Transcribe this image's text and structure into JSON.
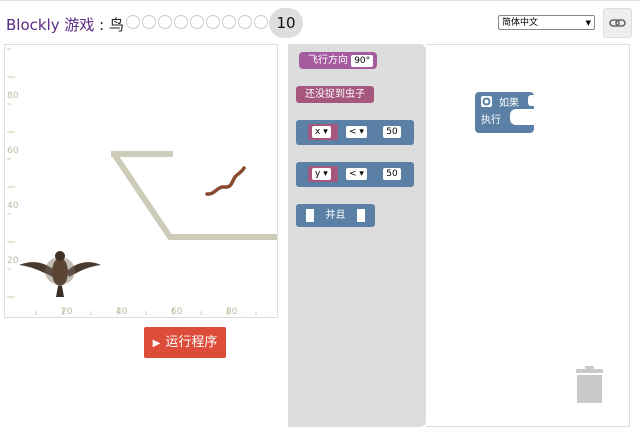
{
  "header": {
    "title_brand": "Blockly 游戏",
    "title_sep": " : ",
    "title_game": "鸟",
    "level_dots_count": 9,
    "current_level": "10",
    "language": "简体中文",
    "link_icon": "link-icon"
  },
  "viz": {
    "y_ticks": [
      "80",
      "60",
      "40",
      "20"
    ],
    "x_ticks": [
      "20",
      "40",
      "60",
      "80"
    ],
    "wall_color": "#ccccb8",
    "bird_icon": "bird-icon",
    "worm_icon": "worm-icon"
  },
  "run": {
    "label": "运行程序",
    "icon": "play-icon",
    "color": "#dd4b39"
  },
  "flyout": {
    "heading_block": {
      "label": "飞行方向",
      "value": "90°"
    },
    "no_worm_block": {
      "label": "还没捉到虫子"
    },
    "compare_x": {
      "var": "x",
      "op": "<",
      "value": "50"
    },
    "compare_y": {
      "var": "y",
      "op": "<",
      "value": "50"
    },
    "and_block": {
      "label": "并且"
    }
  },
  "workspace": {
    "if_block": {
      "if_label": "如果",
      "do_label": "执行"
    },
    "trash_icon": "trash-icon"
  },
  "colors": {
    "heading": "#a55b9f",
    "worm_cond": "#a5577e",
    "logic": "#5b80a5",
    "flyout_bg": "#dddddd"
  }
}
